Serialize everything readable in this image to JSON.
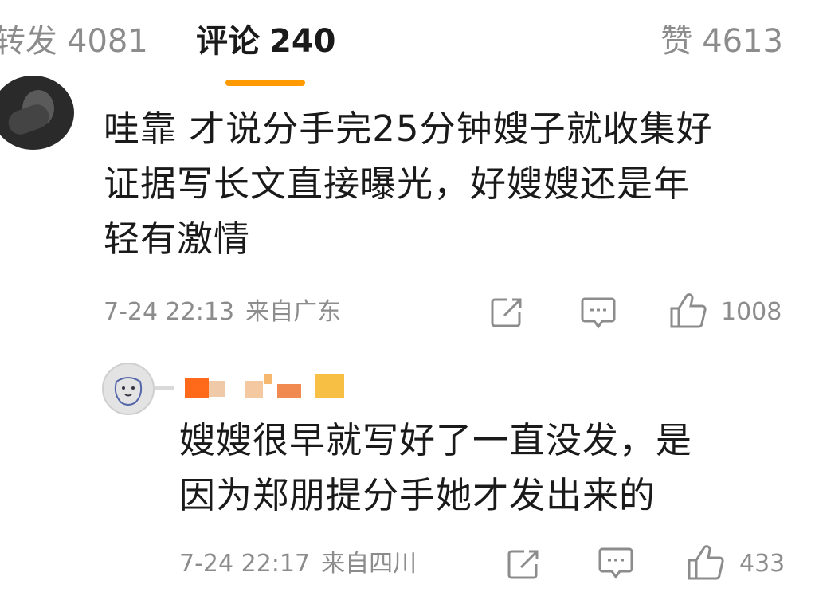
{
  "tabs": {
    "repost": {
      "label": "转发",
      "count": "4081"
    },
    "comments": {
      "label": "评论",
      "count": "240"
    },
    "likes": {
      "label": "赞",
      "count": "4613"
    }
  },
  "colors": {
    "accent": "#ff9a00",
    "muted": "#8c8c8c",
    "text": "#1a1a1a"
  },
  "comments": [
    {
      "lines": [
        "哇靠 才说分手完25分钟嫂子就收集好",
        "证据写长文直接曝光，好嫂嫂还是年",
        "轻有激情"
      ],
      "time": "7-24 22:13",
      "location": "来自广东",
      "likes": "1008",
      "icons": [
        "share-icon",
        "comment-icon",
        "thumbs-up-icon"
      ]
    },
    {
      "lines": [
        "嫂嫂很早就写好了一直没发，是",
        "因为郑朋提分手她才发出来的"
      ],
      "time": "7-24 22:17",
      "location": "来自四川",
      "likes": "433",
      "icons": [
        "share-icon",
        "comment-icon",
        "thumbs-up-icon"
      ]
    }
  ]
}
